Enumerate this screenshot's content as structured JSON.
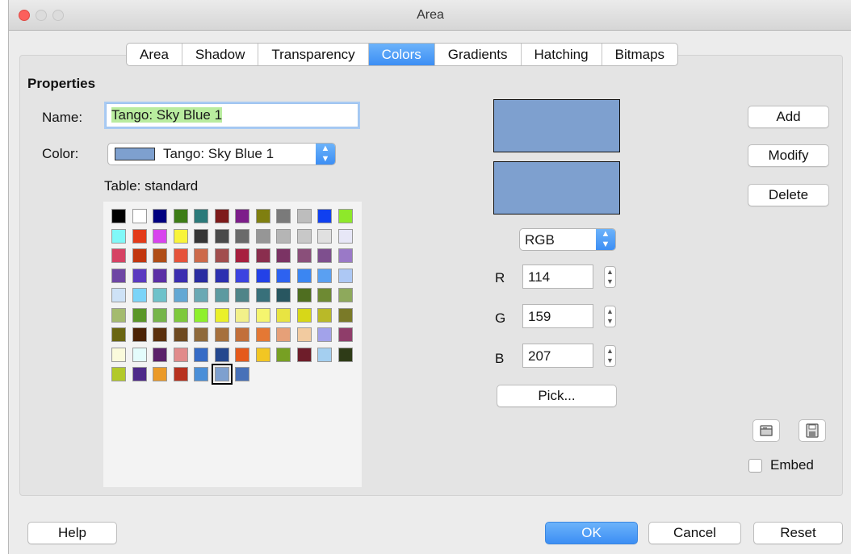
{
  "window": {
    "title": "Area"
  },
  "tabs": [
    {
      "label": "Area"
    },
    {
      "label": "Shadow"
    },
    {
      "label": "Transparency"
    },
    {
      "label": "Colors",
      "active": true
    },
    {
      "label": "Gradients"
    },
    {
      "label": "Hatching"
    },
    {
      "label": "Bitmaps"
    }
  ],
  "properties": {
    "heading": "Properties",
    "name_label": "Name:",
    "name_value": "Tango: Sky Blue 1",
    "color_label": "Color:",
    "color_value": "Tango: Sky Blue 1",
    "color_swatch": "#7ea0cf",
    "table_label": "Table: standard"
  },
  "palette": {
    "rows": [
      [
        "#000000",
        "#ffffff",
        "#000080",
        "#3d7d16",
        "#2b7a7a",
        "#7e1b1b",
        "#7d1e8a",
        "#7f7f10",
        "#7a7a7a",
        "#bdbdbd",
        "#1040f0",
        "#8ee82a"
      ],
      [
        "#80f8f8",
        "#e33b1a",
        "#d844ee",
        "#f8f43a",
        "#353535",
        "#4a4a4a",
        "#6a6a6a",
        "#969696",
        "#b5b5b5",
        "#c8c8c8",
        "#e0e0e0",
        "#e7e7f7"
      ],
      [
        "#d64364",
        "#c2370f",
        "#b04d16",
        "#e6533a",
        "#cd6a4a",
        "#a24e4e",
        "#a71f3e",
        "#8a2e4e",
        "#7b3364",
        "#8a4f7a",
        "#7e4f8e",
        "#9a79c7"
      ],
      [
        "#6e46a4",
        "#5a39c0",
        "#5b2ea6",
        "#3b2db0",
        "#2a2ca1",
        "#2c30b0",
        "#3c43e0",
        "#2341e7",
        "#2d62f0",
        "#3b86f2",
        "#5aa0f2",
        "#adc8f4"
      ],
      [
        "#cee2f6",
        "#7bd4f8",
        "#6ec2ca",
        "#63a8d4",
        "#6aa9b4",
        "#5c9aa0",
        "#4f8488",
        "#38707a",
        "#285660",
        "#4f6e20",
        "#6e8a33",
        "#8ea95c"
      ],
      [
        "#a4bb6f",
        "#5a9628",
        "#76b54a",
        "#7ec93c",
        "#8ef02c",
        "#eaf02a",
        "#f2f08a",
        "#f5f56e",
        "#e8e442",
        "#d7d718",
        "#b9b928",
        "#7a7a28"
      ],
      [
        "#6a6612",
        "#4b2305",
        "#5b300d",
        "#6e4a20",
        "#8f6a3a",
        "#a6703c",
        "#c26f3a",
        "#e47834",
        "#e6a078",
        "#f2cba0",
        "#a2a2ea",
        "#8f3d6a"
      ],
      [
        "#fbfbdc",
        "#e4fcfc",
        "#5b2069",
        "#e18a8a",
        "#356bc6",
        "#24478e",
        "#e55a1c",
        "#f2c623",
        "#77a023",
        "#6e1d2a",
        "#a4cff0",
        "#2e3b17"
      ],
      [
        "#b2c92a",
        "#4e2a8a",
        "#eb9a28",
        "#b8321f",
        "#4a8fd8",
        "#7ea0cf",
        "#4871b8"
      ]
    ],
    "selected": [
      8,
      5
    ]
  },
  "preview": {
    "color": "#7ea0cf"
  },
  "model": {
    "value": "RGB"
  },
  "rgb": {
    "r_label": "R",
    "r_value": "114",
    "g_label": "G",
    "g_value": "159",
    "b_label": "B",
    "b_value": "207"
  },
  "buttons": {
    "pick": "Pick...",
    "add": "Add",
    "modify": "Modify",
    "delete": "Delete",
    "help": "Help",
    "ok": "OK",
    "cancel": "Cancel",
    "reset": "Reset"
  },
  "embed": {
    "label": "Embed",
    "checked": false
  },
  "icons": [
    "folder-open-icon",
    "save-icon"
  ]
}
